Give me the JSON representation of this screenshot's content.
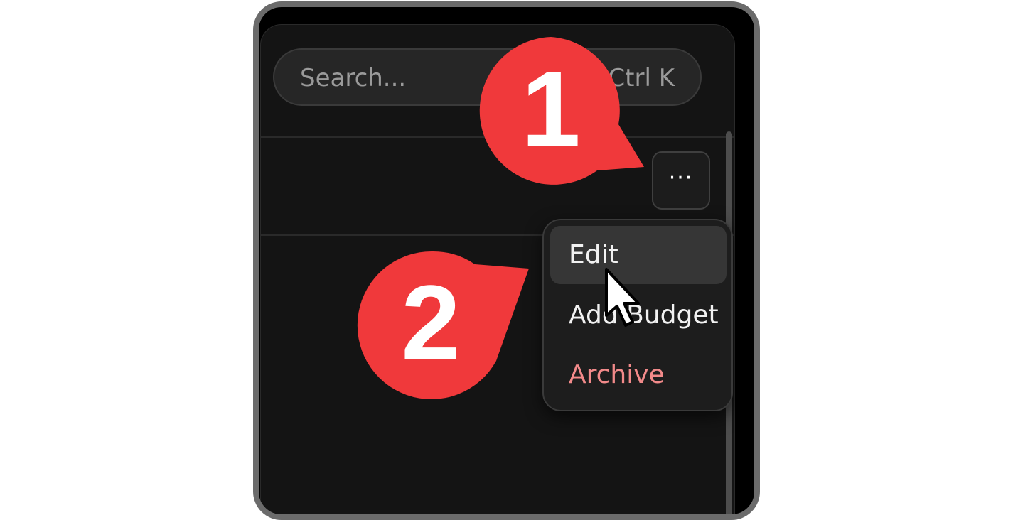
{
  "search": {
    "placeholder": "Search...",
    "shortcut": "Ctrl K"
  },
  "row_actions": {
    "more_label": "···"
  },
  "menu": {
    "items": [
      {
        "label": "Edit",
        "state": "hovered"
      },
      {
        "label": "Add Budget",
        "state": "normal"
      },
      {
        "label": "Archive",
        "state": "danger"
      }
    ]
  },
  "callouts": [
    {
      "label": "1"
    },
    {
      "label": "2"
    }
  ],
  "colors": {
    "callout": "#f0393b",
    "danger_text": "#f28a8a",
    "panel_bg": "#141414",
    "frame": "#6b6b6b"
  }
}
